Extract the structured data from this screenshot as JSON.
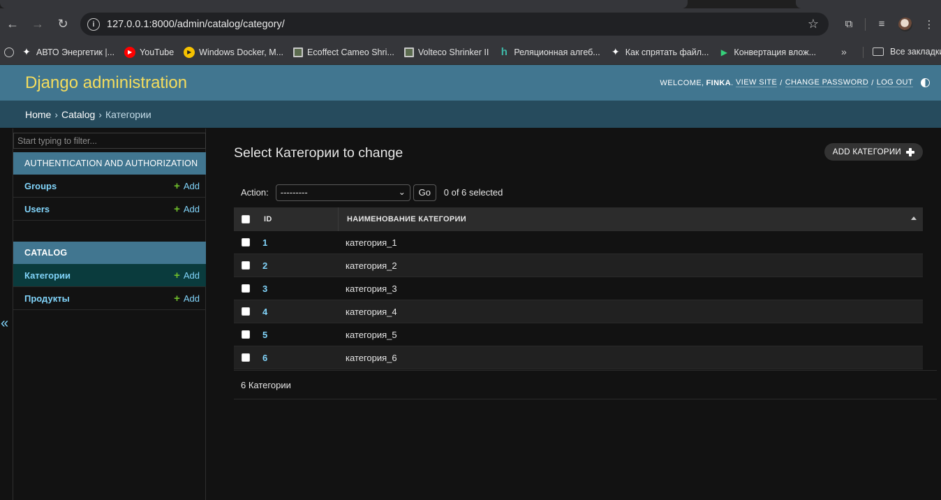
{
  "browser": {
    "url": "127.0.0.1:8000/admin/catalog/category/",
    "bookmarks": [
      {
        "label": "АВТО Энергетик |...",
        "icon": "sparkle-icon"
      },
      {
        "label": "YouTube",
        "icon": "youtube-icon"
      },
      {
        "label": "Windows Docker, M...",
        "icon": "play-circle-icon"
      },
      {
        "label": "Ecoffect Cameo Shri...",
        "icon": "picture-frame-icon"
      },
      {
        "label": "Volteco Shrinker II",
        "icon": "picture-frame-icon"
      },
      {
        "label": "Реляционная алгеб...",
        "icon": "h-logo-icon"
      },
      {
        "label": "Как спрятать файл...",
        "icon": "sparkle-icon"
      },
      {
        "label": "Конвертация влож...",
        "icon": "arrow-play-icon"
      }
    ],
    "bookmarks_folder": "Все закладки"
  },
  "header": {
    "branding": "Django administration",
    "welcome": "WELCOME,",
    "username": "FINKA",
    "view_site": "VIEW SITE",
    "change_password": "CHANGE PASSWORD",
    "log_out": "LOG OUT"
  },
  "breadcrumbs": {
    "home": "Home",
    "app": "Catalog",
    "current": "Категории"
  },
  "sidebar": {
    "filter_placeholder": "Start typing to filter...",
    "apps": [
      {
        "caption": "AUTHENTICATION AND AUTHORIZATION",
        "models": [
          {
            "name": "Groups",
            "add": "Add"
          },
          {
            "name": "Users",
            "add": "Add"
          }
        ]
      },
      {
        "caption": "CATALOG",
        "models": [
          {
            "name": "Категории",
            "add": "Add"
          },
          {
            "name": "Продукты",
            "add": "Add"
          }
        ]
      }
    ],
    "collapse": "«"
  },
  "content": {
    "title": "Select Категории to change",
    "add_button": "ADD КАТЕГОРИИ",
    "action_label": "Action:",
    "action_value": "---------",
    "go": "Go",
    "selected": "0 of 6 selected",
    "columns": {
      "id": "ID",
      "name": "НАИМЕНОВАНИЕ КАТЕГОРИИ"
    },
    "rows": [
      {
        "id": "1",
        "name": "категория_1"
      },
      {
        "id": "2",
        "name": "категория_2"
      },
      {
        "id": "3",
        "name": "категория_3"
      },
      {
        "id": "4",
        "name": "категория_4"
      },
      {
        "id": "5",
        "name": "категория_5"
      },
      {
        "id": "6",
        "name": "категория_6"
      }
    ],
    "paginator": "6 Категории"
  },
  "colors": {
    "header_bg": "#417690",
    "breadcrumbs_bg": "#264b5d",
    "branding": "#f5dd5d",
    "link": "#81d4fa",
    "add_plus": "#70bf2b",
    "selected_model_bg": "#0a3b3d",
    "body_bg": "#121212"
  }
}
